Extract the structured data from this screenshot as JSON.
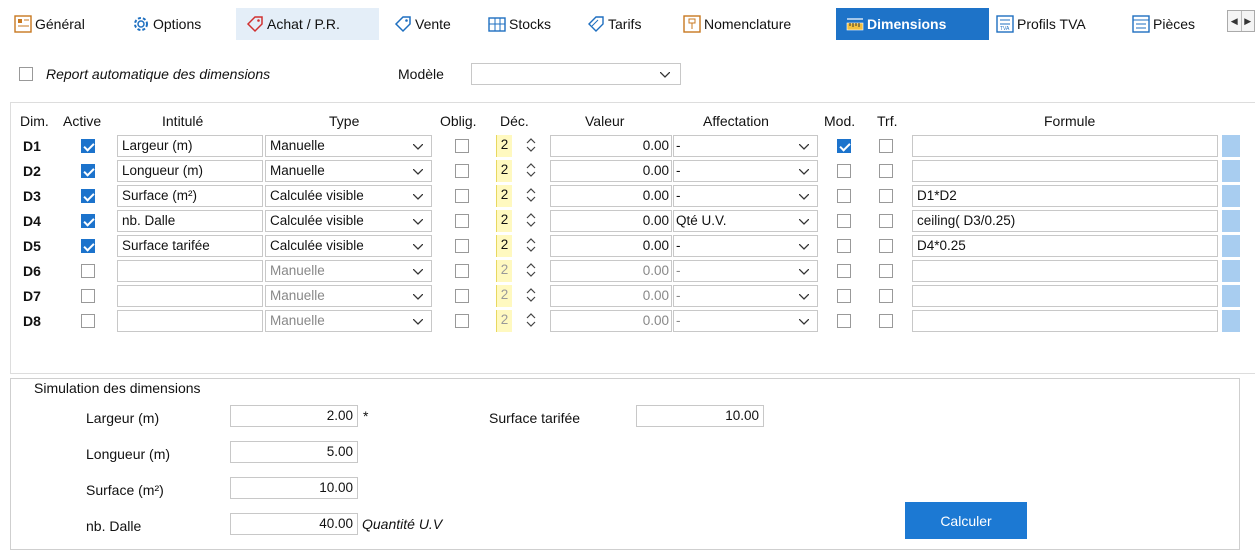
{
  "tabs": [
    {
      "label": "Général",
      "icon": "general-icon"
    },
    {
      "label": "Options",
      "icon": "gear-icon"
    },
    {
      "label": "Achat / P.R.",
      "icon": "purchase-tag-icon"
    },
    {
      "label": "Vente",
      "icon": "tag-icon"
    },
    {
      "label": "Stocks",
      "icon": "stocks-icon"
    },
    {
      "label": "Tarifs",
      "icon": "tariffs-icon"
    },
    {
      "label": "Nomenclature",
      "icon": "nomenclature-icon"
    },
    {
      "label": "Dimensions",
      "icon": "ruler-icon"
    },
    {
      "label": "Profils TVA",
      "icon": "tva-icon"
    },
    {
      "label": "Pièces",
      "icon": "pieces-icon"
    }
  ],
  "options": {
    "auto_report_label": "Report automatique des dimensions",
    "auto_report_checked": false,
    "modele_label": "Modèle",
    "modele_value": ""
  },
  "columns": [
    "Dim.",
    "Active",
    "Intitulé",
    "Type",
    "Oblig.",
    "Déc.",
    "Valeur",
    "Affectation",
    "Mod.",
    "Trf.",
    "Formule"
  ],
  "rows": [
    {
      "dim": "D1",
      "active": true,
      "intitule": "Largeur (m)",
      "type": "Manuelle",
      "oblig": false,
      "dec": "2",
      "valeur": "0.00",
      "affectation": "-",
      "mod": true,
      "trf": false,
      "formule": ""
    },
    {
      "dim": "D2",
      "active": true,
      "intitule": "Longueur (m)",
      "type": "Manuelle",
      "oblig": false,
      "dec": "2",
      "valeur": "0.00",
      "affectation": "-",
      "mod": false,
      "trf": false,
      "formule": ""
    },
    {
      "dim": "D3",
      "active": true,
      "intitule": "Surface (m²)",
      "type": "Calculée visible",
      "oblig": false,
      "dec": "2",
      "valeur": "0.00",
      "affectation": "-",
      "mod": false,
      "trf": false,
      "formule": "D1*D2"
    },
    {
      "dim": "D4",
      "active": true,
      "intitule": "nb. Dalle",
      "type": "Calculée visible",
      "oblig": false,
      "dec": "2",
      "valeur": "0.00",
      "affectation": "Qté U.V.",
      "mod": false,
      "trf": false,
      "formule": "ceiling( D3/0.25)"
    },
    {
      "dim": "D5",
      "active": true,
      "intitule": "Surface tarifée",
      "type": "Calculée visible",
      "oblig": false,
      "dec": "2",
      "valeur": "0.00",
      "affectation": "-",
      "mod": false,
      "trf": false,
      "formule": "D4*0.25"
    },
    {
      "dim": "D6",
      "active": false,
      "intitule": "",
      "type": "Manuelle",
      "oblig": false,
      "dec": "2",
      "valeur": "0.00",
      "affectation": "-",
      "mod": false,
      "trf": false,
      "formule": ""
    },
    {
      "dim": "D7",
      "active": false,
      "intitule": "",
      "type": "Manuelle",
      "oblig": false,
      "dec": "2",
      "valeur": "0.00",
      "affectation": "-",
      "mod": false,
      "trf": false,
      "formule": ""
    },
    {
      "dim": "D8",
      "active": false,
      "intitule": "",
      "type": "Manuelle",
      "oblig": false,
      "dec": "2",
      "valeur": "0.00",
      "affectation": "-",
      "mod": false,
      "trf": false,
      "formule": ""
    }
  ],
  "simulation": {
    "title": "Simulation des dimensions",
    "fields": [
      {
        "label": "Largeur (m)",
        "value": "2.00",
        "suffix": "*"
      },
      {
        "label": "Longueur (m)",
        "value": "5.00",
        "suffix": ""
      },
      {
        "label": "Surface (m²)",
        "value": "10.00",
        "suffix": ""
      },
      {
        "label": "nb. Dalle",
        "value": "40.00",
        "suffix": "Quantité U.V"
      }
    ],
    "surface_tarifee_label": "Surface tarifée",
    "surface_tarifee_value": "10.00",
    "calc_button": "Calculer"
  },
  "colors": {
    "accent": "#1e73c8",
    "decimals_bg": "#fff9c0",
    "button": "#1c79d3"
  }
}
